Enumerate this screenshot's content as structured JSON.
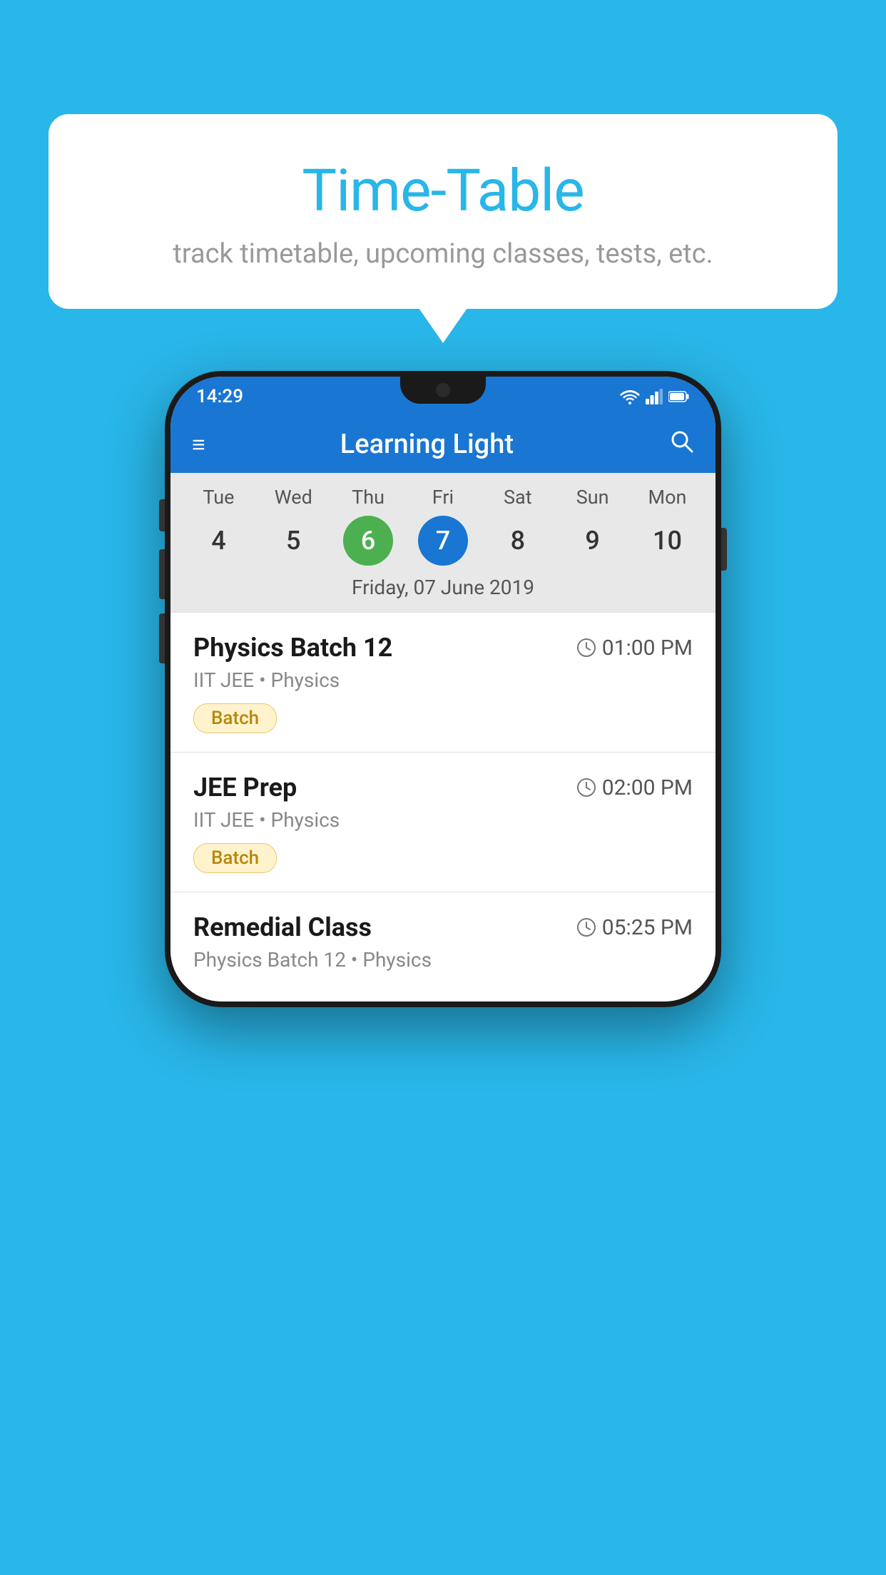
{
  "background": {
    "color": "#29b6e8"
  },
  "speech_bubble": {
    "title": "Time-Table",
    "subtitle": "track timetable, upcoming classes, tests, etc."
  },
  "phone": {
    "status_bar": {
      "time": "14:29"
    },
    "top_bar": {
      "title": "Learning Light",
      "hamburger_label": "≡",
      "search_label": "🔍"
    },
    "calendar": {
      "days": [
        {
          "name": "Tue",
          "num": "4",
          "state": "normal"
        },
        {
          "name": "Wed",
          "num": "5",
          "state": "normal"
        },
        {
          "name": "Thu",
          "num": "6",
          "state": "today"
        },
        {
          "name": "Fri",
          "num": "7",
          "state": "selected"
        },
        {
          "name": "Sat",
          "num": "8",
          "state": "normal"
        },
        {
          "name": "Sun",
          "num": "9",
          "state": "normal"
        },
        {
          "name": "Mon",
          "num": "10",
          "state": "normal"
        }
      ],
      "selected_date": "Friday, 07 June 2019"
    },
    "schedule": [
      {
        "name": "Physics Batch 12",
        "time": "01:00 PM",
        "sub": "IIT JEE • Physics",
        "badge": "Batch"
      },
      {
        "name": "JEE Prep",
        "time": "02:00 PM",
        "sub": "IIT JEE • Physics",
        "badge": "Batch"
      },
      {
        "name": "Remedial Class",
        "time": "05:25 PM",
        "sub": "Physics Batch 12 • Physics",
        "badge": null
      }
    ]
  }
}
